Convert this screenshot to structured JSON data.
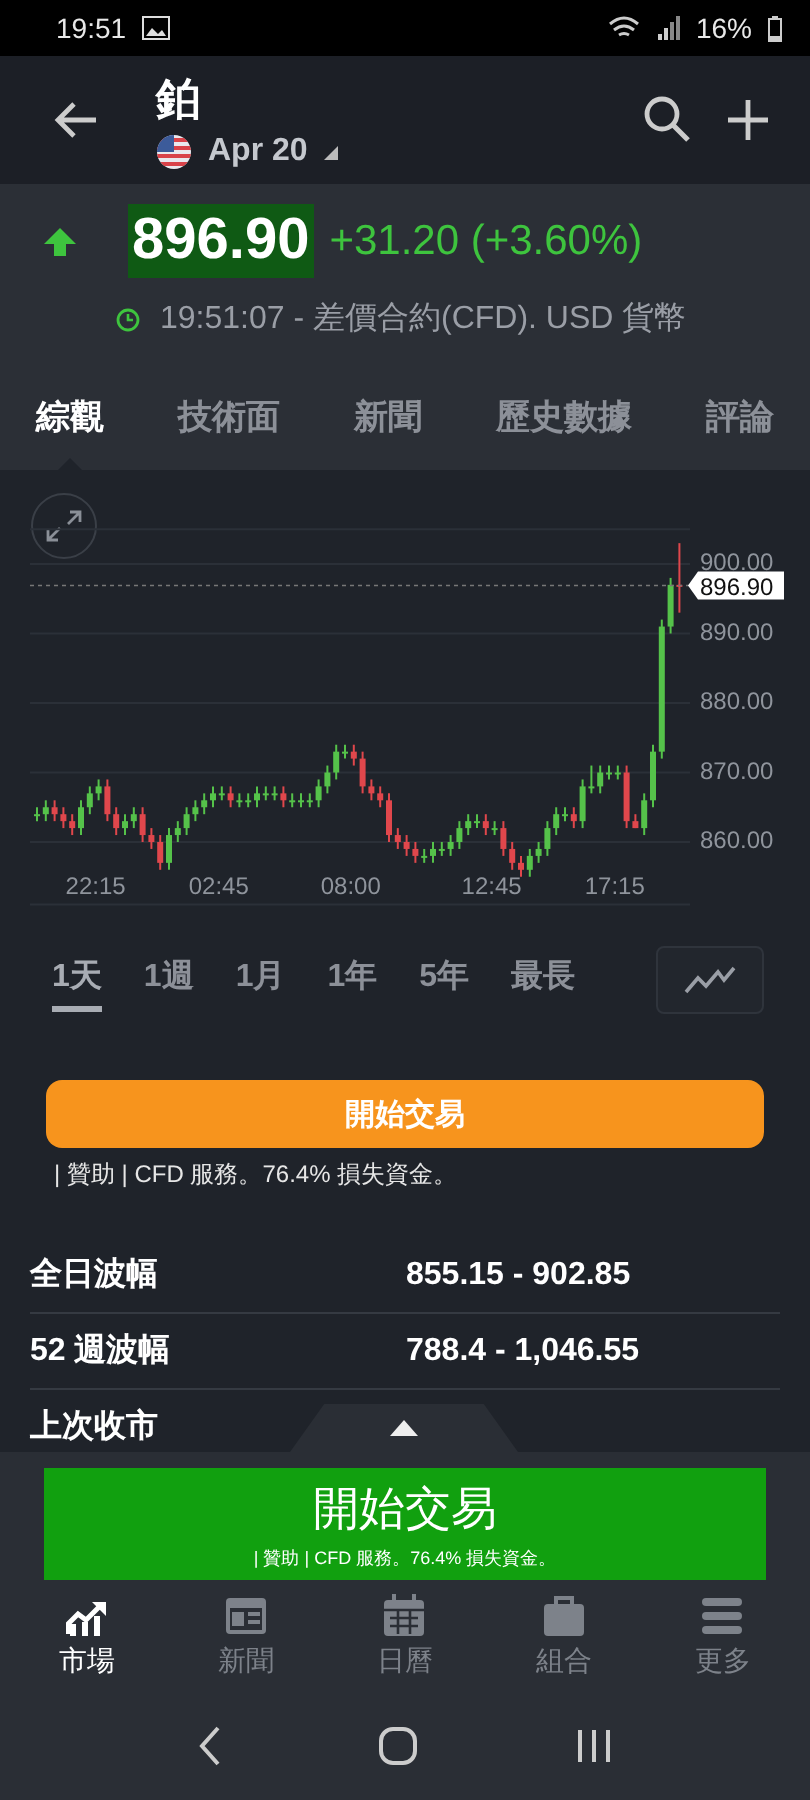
{
  "status_bar": {
    "time": "19:51",
    "battery": "16%"
  },
  "app_bar": {
    "title": "鉑",
    "contract": "Apr 20"
  },
  "quote": {
    "price": "896.90",
    "change": "+31.20 (+3.60%)",
    "rising": true,
    "info": "19:51:07 - 差價合約(CFD). USD 貨幣"
  },
  "tabs": [
    {
      "label": "綜觀",
      "selected": true
    },
    {
      "label": "技術面",
      "selected": false
    },
    {
      "label": "新聞",
      "selected": false
    },
    {
      "label": "歷史數據",
      "selected": false
    },
    {
      "label": "評論",
      "selected": false
    }
  ],
  "chart": {
    "chart_data": {
      "type": "candlestick",
      "grid": true,
      "ylim": [
        851,
        905
      ],
      "ref_lines": [
        {
          "axis": "y",
          "value": 896.9,
          "label": "896.90"
        }
      ],
      "categories": [
        null,
        null,
        null,
        null,
        null,
        null,
        null,
        "22:15",
        null,
        null,
        null,
        null,
        null,
        null,
        null,
        null,
        null,
        null,
        null,
        null,
        null,
        "02:45",
        null,
        null,
        null,
        null,
        null,
        null,
        null,
        null,
        null,
        null,
        null,
        null,
        null,
        null,
        "08:00",
        null,
        null,
        null,
        null,
        null,
        null,
        null,
        null,
        null,
        null,
        null,
        null,
        null,
        null,
        null,
        "12:45",
        null,
        null,
        null,
        null,
        null,
        null,
        null,
        null,
        null,
        null,
        null,
        null,
        null,
        "17:15",
        null,
        null,
        null,
        null,
        null,
        null,
        null
      ],
      "yticks": [
        {
          "value": 900,
          "label": "900.00"
        },
        {
          "value": 890,
          "label": "890.00"
        },
        {
          "value": 880,
          "label": "880.00"
        },
        {
          "value": 870,
          "label": "870.00"
        },
        {
          "value": 860,
          "label": "860.00"
        }
      ],
      "ohlc": [
        [
          864,
          865,
          863,
          864
        ],
        [
          864,
          866,
          863,
          865
        ],
        [
          865,
          866,
          863,
          864
        ],
        [
          864,
          865,
          862,
          863
        ],
        [
          863,
          864,
          861,
          862
        ],
        [
          862,
          866,
          861,
          865
        ],
        [
          865,
          868,
          864,
          867
        ],
        [
          867,
          869,
          866,
          868
        ],
        [
          868,
          869,
          863,
          864
        ],
        [
          864,
          865,
          861,
          862
        ],
        [
          862,
          864,
          861,
          863
        ],
        [
          863,
          865,
          862,
          864
        ],
        [
          864,
          865,
          860,
          861
        ],
        [
          861,
          862,
          859,
          860
        ],
        [
          860,
          861,
          856,
          857
        ],
        [
          857,
          862,
          856,
          861
        ],
        [
          861,
          863,
          860,
          862
        ],
        [
          862,
          865,
          861,
          864
        ],
        [
          864,
          866,
          863,
          865
        ],
        [
          865,
          867,
          864,
          866
        ],
        [
          866,
          868,
          865,
          867
        ],
        [
          867,
          868,
          866,
          867
        ],
        [
          867,
          868,
          865,
          866
        ],
        [
          866,
          867,
          865,
          866
        ],
        [
          866,
          867,
          865,
          866
        ],
        [
          866,
          868,
          865,
          867
        ],
        [
          867,
          868,
          866,
          867
        ],
        [
          867,
          868,
          866,
          867
        ],
        [
          867,
          868,
          865,
          866
        ],
        [
          866,
          867,
          865,
          866
        ],
        [
          866,
          867,
          865,
          866
        ],
        [
          866,
          867,
          865,
          866
        ],
        [
          866,
          869,
          865,
          868
        ],
        [
          868,
          871,
          867,
          870
        ],
        [
          870,
          874,
          869,
          873
        ],
        [
          873,
          874,
          872,
          873
        ],
        [
          873,
          874,
          871,
          872
        ],
        [
          872,
          873,
          867,
          868
        ],
        [
          868,
          869,
          866,
          867
        ],
        [
          867,
          868,
          865,
          866
        ],
        [
          866,
          867,
          860,
          861
        ],
        [
          861,
          862,
          859,
          860
        ],
        [
          860,
          861,
          858,
          859
        ],
        [
          859,
          860,
          857,
          858
        ],
        [
          858,
          859,
          857,
          858
        ],
        [
          858,
          860,
          857,
          859
        ],
        [
          859,
          860,
          858,
          859
        ],
        [
          859,
          861,
          858,
          860
        ],
        [
          860,
          863,
          859,
          862
        ],
        [
          862,
          864,
          861,
          863
        ],
        [
          863,
          864,
          862,
          863
        ],
        [
          863,
          864,
          861,
          862
        ],
        [
          862,
          863,
          861,
          862
        ],
        [
          862,
          863,
          858,
          859
        ],
        [
          859,
          860,
          856,
          857
        ],
        [
          857,
          858,
          855,
          856
        ],
        [
          856,
          859,
          855,
          858
        ],
        [
          858,
          860,
          857,
          859
        ],
        [
          859,
          863,
          858,
          862
        ],
        [
          862,
          865,
          861,
          864
        ],
        [
          864,
          865,
          863,
          864
        ],
        [
          864,
          865,
          862,
          863
        ],
        [
          863,
          869,
          862,
          868
        ],
        [
          868,
          871,
          867,
          868
        ],
        [
          868,
          871,
          867,
          870
        ],
        [
          870,
          871,
          869,
          870
        ],
        [
          870,
          871,
          869,
          870
        ],
        [
          870,
          871,
          862,
          863
        ],
        [
          863,
          864,
          862,
          862
        ],
        [
          862,
          867,
          861,
          866
        ],
        [
          866,
          874,
          865,
          873
        ],
        [
          873,
          892,
          872,
          891
        ],
        [
          891,
          898,
          890,
          897
        ],
        [
          897,
          903,
          893,
          896.9
        ]
      ]
    }
  },
  "ranges": [
    {
      "label": "1天",
      "selected": true
    },
    {
      "label": "1週",
      "selected": false
    },
    {
      "label": "1月",
      "selected": false
    },
    {
      "label": "1年",
      "selected": false
    },
    {
      "label": "5年",
      "selected": false
    },
    {
      "label": "最長",
      "selected": false
    }
  ],
  "trade": {
    "button": "開始交易",
    "disclaimer": "| 贊助 | CFD 服務。76.4% 損失資金。"
  },
  "stats": [
    {
      "label": "全日波幅",
      "value": "855.15 - 902.85"
    },
    {
      "label": "52 週波幅",
      "value": "788.4 - 1,046.55"
    },
    {
      "label": "上次收市"
    }
  ],
  "bottom_trade": {
    "button": "開始交易",
    "disclaimer": "| 贊助 | CFD 服務。76.4% 損失資金。"
  },
  "nav": [
    {
      "label": "市場",
      "selected": true
    },
    {
      "label": "新聞",
      "selected": false
    },
    {
      "label": "日曆",
      "selected": false
    },
    {
      "label": "組合",
      "selected": false
    },
    {
      "label": "更多",
      "selected": false
    }
  ]
}
